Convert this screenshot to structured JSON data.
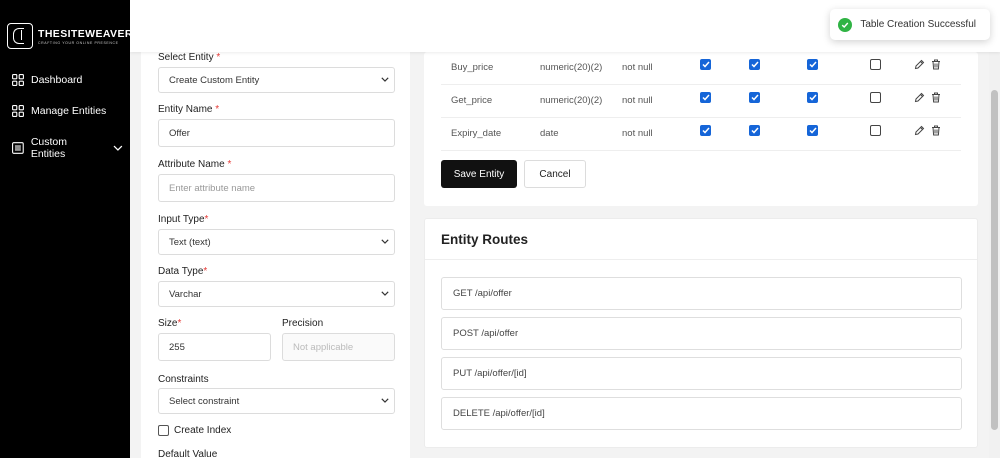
{
  "brand": {
    "name": "THESITEWEAVER",
    "tagline": "CRAFTING YOUR ONLINE PRESENCE"
  },
  "sidebar": {
    "items": [
      {
        "label": "Dashboard",
        "icon": "grid-icon"
      },
      {
        "label": "Manage Entities",
        "icon": "grid-icon"
      },
      {
        "label": "Custom Entities",
        "icon": "list-icon",
        "expandable": true
      }
    ]
  },
  "toast": {
    "message": "Table Creation Successful",
    "status_color": "#2fb344"
  },
  "form": {
    "select_entity": {
      "label": "Select Entity",
      "value": "Create Custom Entity"
    },
    "entity_name": {
      "label": "Entity Name",
      "value": "Offer"
    },
    "attribute_name": {
      "label": "Attribute Name",
      "placeholder": "Enter attribute name"
    },
    "input_type": {
      "label": "Input Type",
      "value": "Text (text)"
    },
    "data_type": {
      "label": "Data Type",
      "value": "Varchar"
    },
    "size": {
      "label": "Size",
      "value": "255"
    },
    "precision": {
      "label": "Precision",
      "placeholder": "Not applicable"
    },
    "constraints": {
      "label": "Constraints",
      "value": "Select constraint"
    },
    "create_index": {
      "label": "Create Index",
      "checked": false
    },
    "default_value": {
      "label": "Default Value"
    }
  },
  "attributes_table": {
    "rows": [
      {
        "name": "Buy_price",
        "type": "numeric(20)(2)",
        "constraint": "not null",
        "flags": [
          true,
          true,
          true,
          false
        ]
      },
      {
        "name": "Get_price",
        "type": "numeric(20)(2)",
        "constraint": "not null",
        "flags": [
          true,
          true,
          true,
          false
        ]
      },
      {
        "name": "Expiry_date",
        "type": "date",
        "constraint": "not null",
        "flags": [
          true,
          true,
          true,
          false
        ]
      }
    ]
  },
  "actions": {
    "save_label": "Save Entity",
    "cancel_label": "Cancel"
  },
  "routes": {
    "title": "Entity Routes",
    "items": [
      "GET /api/offer",
      "POST /api/offer",
      "PUT /api/offer/[id]",
      "DELETE /api/offer/[id]"
    ]
  },
  "colors": {
    "accent": "#1565d8",
    "primary_button": "#111111",
    "required": "#e53935"
  }
}
